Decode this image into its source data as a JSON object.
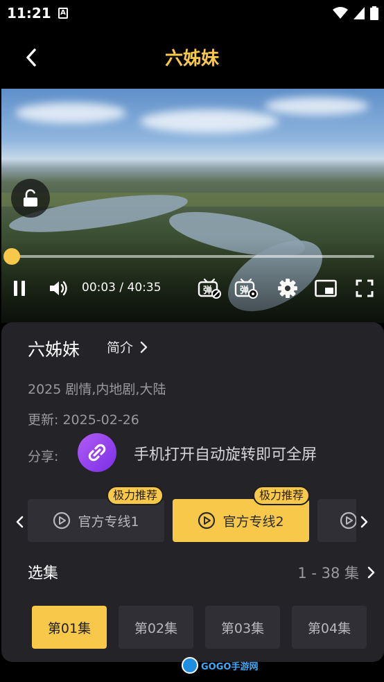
{
  "status_bar": {
    "time": "11:21",
    "notification_glyph": "A"
  },
  "header": {
    "title": "六姊妹"
  },
  "player": {
    "current_time": "00:03",
    "separator": " / ",
    "duration": "40:35",
    "progress_fraction": 0.0012
  },
  "detail": {
    "show_name": "六姊妹",
    "intro_label": "简介",
    "info_line": "2025 剧情,内地剧,大陆",
    "update_label": "更新:",
    "update_date": "2025-02-26",
    "share_label": "分享:",
    "share_hint": "手机打开自动旋转即可全屏"
  },
  "source_lines": [
    {
      "label": "官方专线1",
      "badge": "极力推荐",
      "active": false
    },
    {
      "label": "官方专线2",
      "badge": "极力推荐",
      "active": true
    },
    {
      "label": "",
      "badge": "",
      "active": false
    }
  ],
  "episodes": {
    "title": "选集",
    "range": "1 - 38 集",
    "items": [
      {
        "label": "第01集",
        "active": true
      },
      {
        "label": "第02集",
        "active": false
      },
      {
        "label": "第03集",
        "active": false
      },
      {
        "label": "第04集",
        "active": false
      }
    ]
  },
  "watermark": {
    "brand": "GOGO手游网"
  },
  "colors": {
    "accent": "#f7c84a",
    "panel": "#232328",
    "tab": "#2f2f35",
    "share": "#9b3ff0"
  }
}
